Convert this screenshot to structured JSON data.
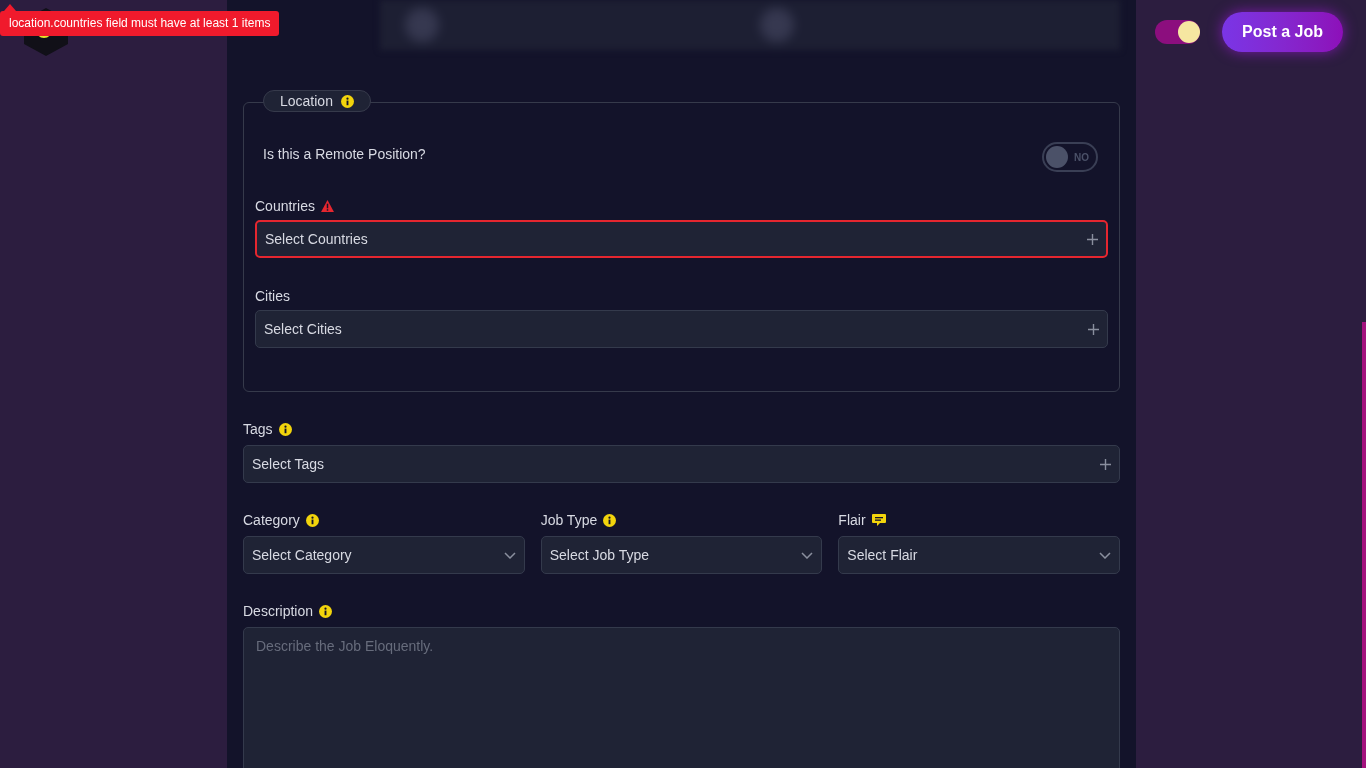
{
  "error_tooltip": "location.countries field must have at least 1 items",
  "header": {
    "theme_toggle": {
      "on": true
    },
    "post_job_button": "Post a Job"
  },
  "location": {
    "legend": "Location",
    "remote_question": "Is this a Remote Position?",
    "remote_toggle": {
      "on": false,
      "label": "NO"
    },
    "fields": [
      {
        "label": "Countries",
        "placeholder": "Select Countries",
        "kind": "multi",
        "error": true
      },
      {
        "label": "Cities",
        "placeholder": "Select Cities",
        "kind": "multi",
        "error": false
      }
    ]
  },
  "tags": {
    "label": "Tags",
    "placeholder": "Select Tags",
    "kind": "multi",
    "error": false
  },
  "selects": [
    {
      "label": "Category",
      "placeholder": "Select Category",
      "kind": "select"
    },
    {
      "label": "Job Type",
      "placeholder": "Select Job Type",
      "kind": "select"
    },
    {
      "label": "Flair",
      "placeholder": "Select Flair",
      "kind": "select"
    }
  ],
  "description": {
    "label": "Description",
    "placeholder": "Describe the Job Eloquently."
  }
}
